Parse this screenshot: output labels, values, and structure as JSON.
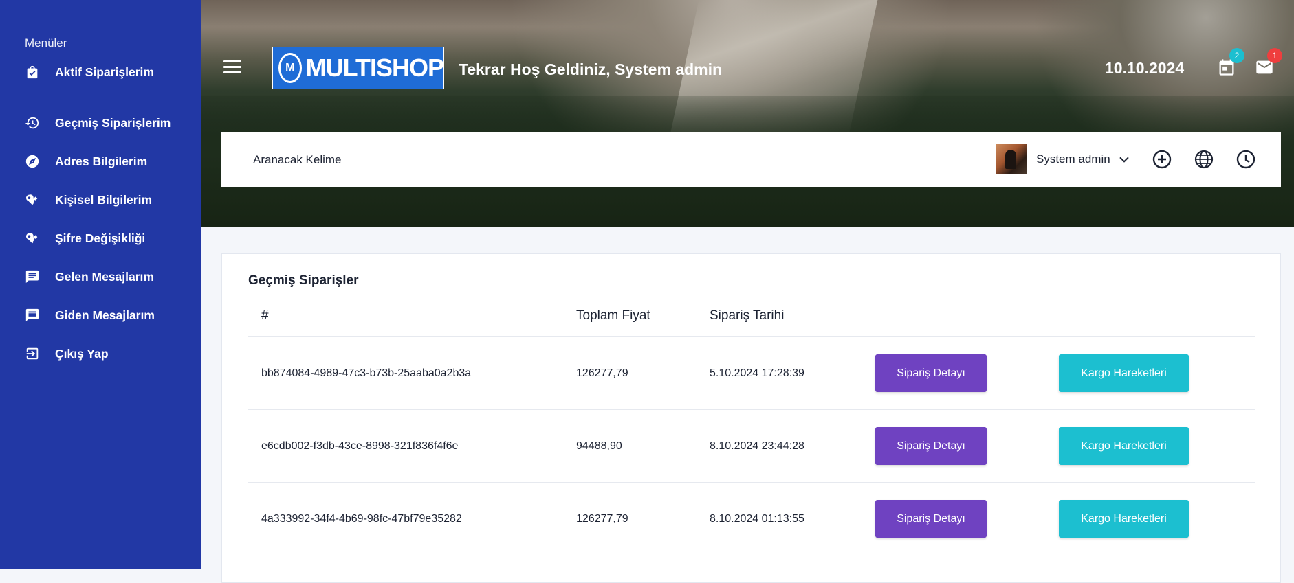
{
  "sidebar": {
    "heading": "Menüler",
    "items": [
      {
        "label": "Aktif Siparişlerim",
        "icon": "shopping-bag-icon"
      },
      {
        "label": "Geçmiş Siparişlerim",
        "icon": "history-icon"
      },
      {
        "label": "Adres Bilgilerim",
        "icon": "compass-icon"
      },
      {
        "label": "Kişisel Bilgilerim",
        "icon": "key-icon"
      },
      {
        "label": "Şifre Değişikliği",
        "icon": "key-icon"
      },
      {
        "label": "Gelen Mesajlarım",
        "icon": "chat-icon"
      },
      {
        "label": "Giden Mesajlarım",
        "icon": "message-icon"
      },
      {
        "label": "Çıkış Yap",
        "icon": "logout-icon"
      }
    ],
    "bg_color": "#2238a5"
  },
  "header": {
    "logo_text": "MULTISHOP",
    "logo_mark": "M",
    "welcome": "Tekrar Hoş Geldiniz, System admin",
    "date": "10.10.2024",
    "calendar_badge": "2",
    "mail_badge": "1",
    "calendar_badge_color": "#1cbfd0",
    "mail_badge_color": "#ef3e3e"
  },
  "searchbar": {
    "placeholder": "Aranacak Kelime",
    "user_name": "System admin"
  },
  "orders": {
    "title": "Geçmiş Siparişler",
    "columns": [
      "#",
      "Toplam Fiyat",
      "Sipariş Tarihi"
    ],
    "detail_label": "Sipariş Detayı",
    "cargo_label": "Kargo Hareketleri",
    "rows": [
      {
        "id": "bb874084-4989-47c3-b73b-25aaba0a2b3a",
        "total": "126277,79",
        "date": "5.10.2024 17:28:39"
      },
      {
        "id": "e6cdb002-f3db-43ce-8998-321f836f4f6e",
        "total": "94488,90",
        "date": "8.10.2024 23:44:28"
      },
      {
        "id": "4a333992-34f4-4b69-98fc-47bf79e35282",
        "total": "126277,79",
        "date": "8.10.2024 01:13:55"
      }
    ]
  },
  "colors": {
    "detail_button": "#6f42c1",
    "cargo_button": "#1cbfd0"
  }
}
